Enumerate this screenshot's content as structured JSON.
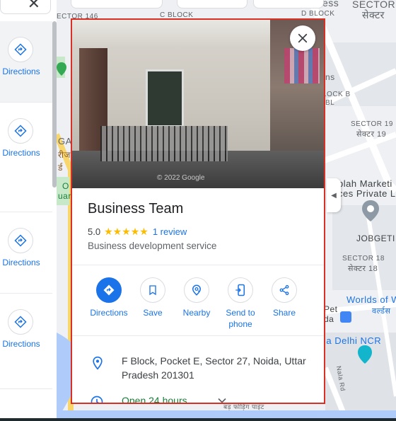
{
  "list": {
    "close_glyph": "✕",
    "items": [
      {
        "label": "Directions"
      },
      {
        "label": "Directions"
      },
      {
        "label": "Directions"
      },
      {
        "label": "Directions"
      }
    ]
  },
  "map_labels": {
    "sector_146": "ECTOR 146",
    "c_block": "C BLOCK",
    "d_block": "D BLOCK",
    "ess": "ess",
    "sector_top": "SECTOR",
    "sector_top_hi": "सेक्टर",
    "ns": "ns",
    "block_b": "LOCK B",
    "bl": "BL",
    "sector_19": "SECTOR 19",
    "sector_19_hi": "सेक्टर 19",
    "ga": "GA",
    "rej": "रीज",
    "cud": "र्ड",
    "o": "O",
    "uar": "uar",
    "blah_market": "blah Marketi",
    "ces_private": "ces Private L",
    "jobgeti": "JOBGETI",
    "sector_18": "SECTOR 18",
    "sector_18_hi": "सेक्टर 18",
    "worlds_of": "Worlds of W",
    "worlds_hi": "वर्ल्डस",
    "pet": "Pet",
    "da": "da",
    "ia_delhi": "ia Delhi NCR",
    "nala_rd": "Nala Rd",
    "bottom_hi": "बड़ फोड़िंग पाइंट"
  },
  "place": {
    "photo_credit": "© 2022 Google",
    "close_glyph": "✕",
    "name": "Business Team",
    "rating": "5.0",
    "stars": "★★★★★",
    "reviews": "1 review",
    "category": "Business development service",
    "actions": [
      {
        "label": "Directions",
        "icon": "directions-icon"
      },
      {
        "label": "Save",
        "icon": "bookmark-icon"
      },
      {
        "label": "Nearby",
        "icon": "nearby-icon"
      },
      {
        "label": "Send to phone",
        "icon": "send-to-phone-icon"
      },
      {
        "label": "Share",
        "icon": "share-icon"
      }
    ],
    "address": "F Block, Pocket E, Sector 27, Noida, Uttar Pradesh 201301",
    "hours": "Open 24 hours"
  },
  "colors": {
    "accent": "#1a73e8",
    "highlight_border": "#d93025",
    "star": "#fbbc04",
    "open_green": "#188038"
  }
}
